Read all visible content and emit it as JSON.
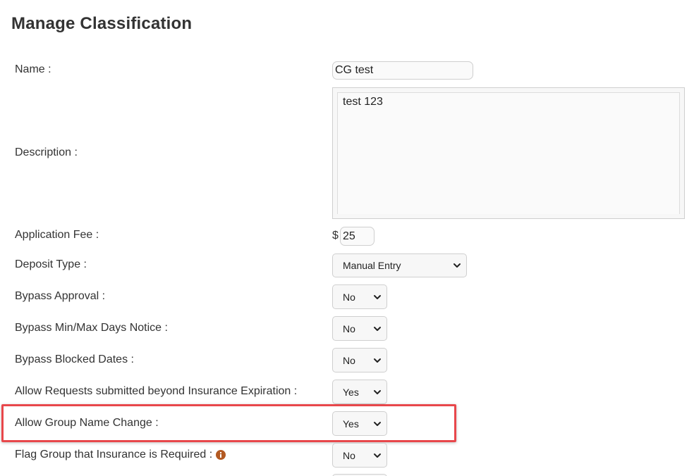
{
  "page": {
    "title": "Manage Classification"
  },
  "form": {
    "name": {
      "label": "Name :",
      "value": "CG test"
    },
    "description": {
      "label": "Description :",
      "value": "test 123"
    },
    "application_fee": {
      "label": "Application Fee :",
      "currency": "$",
      "value": "25"
    },
    "deposit_type": {
      "label": "Deposit Type :",
      "value": "Manual Entry"
    },
    "bypass_approval": {
      "label": "Bypass Approval :",
      "value": "No"
    },
    "bypass_min_max_days": {
      "label": "Bypass Min/Max Days Notice :",
      "value": "No"
    },
    "bypass_blocked_dates": {
      "label": "Bypass Blocked Dates :",
      "value": "No"
    },
    "allow_requests_beyond_insurance": {
      "label": "Allow Requests submitted beyond Insurance Expiration :",
      "value": "Yes"
    },
    "allow_group_name_change": {
      "label": "Allow Group Name Change :",
      "value": "Yes"
    },
    "flag_group_insurance_required": {
      "label": "Flag Group that Insurance is Required :",
      "value": "No",
      "info_icon": "info-circle-icon"
    }
  },
  "highlight": {
    "color": "#e8474b"
  },
  "colors": {
    "info_icon": "#b35a22",
    "text": "#333333",
    "input_border": "#cfcfcf",
    "input_bg": "#fafafa"
  }
}
